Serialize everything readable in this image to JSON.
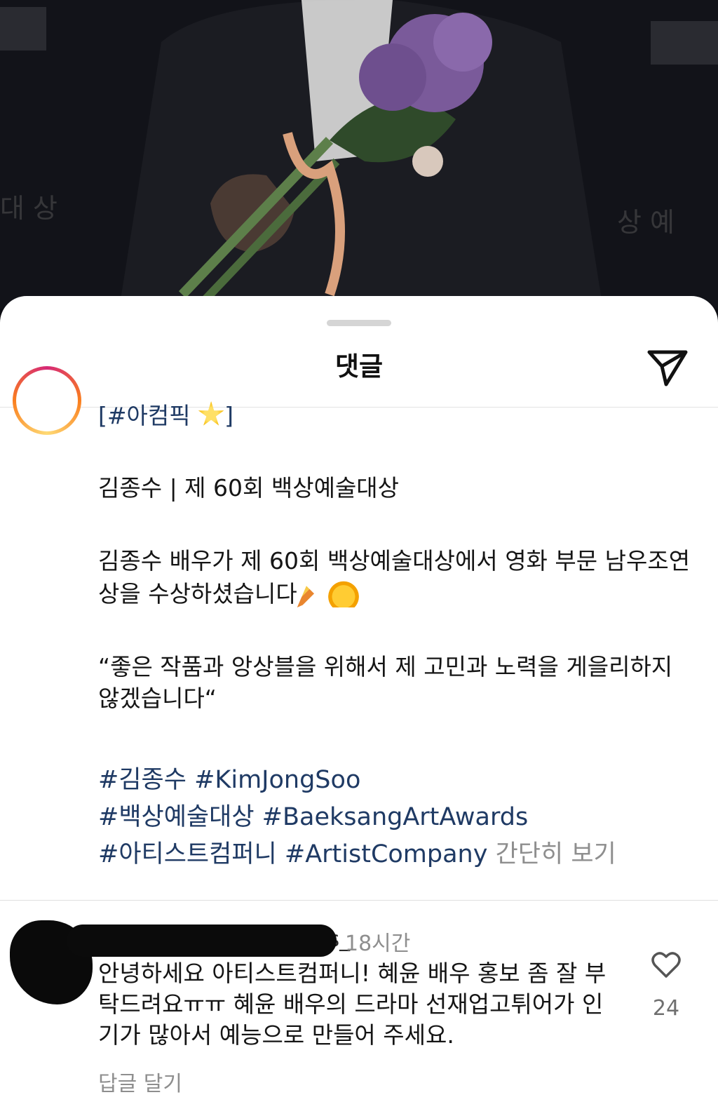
{
  "header": {
    "title": "댓글"
  },
  "icons": {
    "share": "paper-plane-icon",
    "like": "heart-icon"
  },
  "post": {
    "caption_title": "[#아컴픽 ",
    "caption_title_close": "]",
    "line1": "김종수 | 제 60회 백상예술대상",
    "line2": "김종수 배우가 제 60회 백상예술대상에서 영화 부문 남우조연상을 수상하셨습니다",
    "line3": "“좋은 작품과 앙상블을 위해서 제 고민과 노력을 게을리하지 않겠습니다“",
    "hashtags": [
      "#김종수",
      "#KimJongSoo",
      "#백상예술대상",
      "#BaeksangArtAwards",
      "#아티스트컴퍼니",
      "#ArtistCompany"
    ],
    "see_less": "간단히 보기"
  },
  "comment": {
    "username_tail": "piness_",
    "time": "18시간",
    "text": "안녕하세요 아티스트컴퍼니! 혜윤 배우 홍보 좀 잘 부탁드려요ㅠㅠ 혜윤 배우의 드라마 선재업고튀어가 인기가 많아서 예능으로 만들어 주세요.",
    "likes": "24",
    "reply_label": "답글 달기"
  },
  "colors": {
    "hashtag": "#1f3a64",
    "muted": "#8e8e8e",
    "sheet": "#ffffff"
  }
}
